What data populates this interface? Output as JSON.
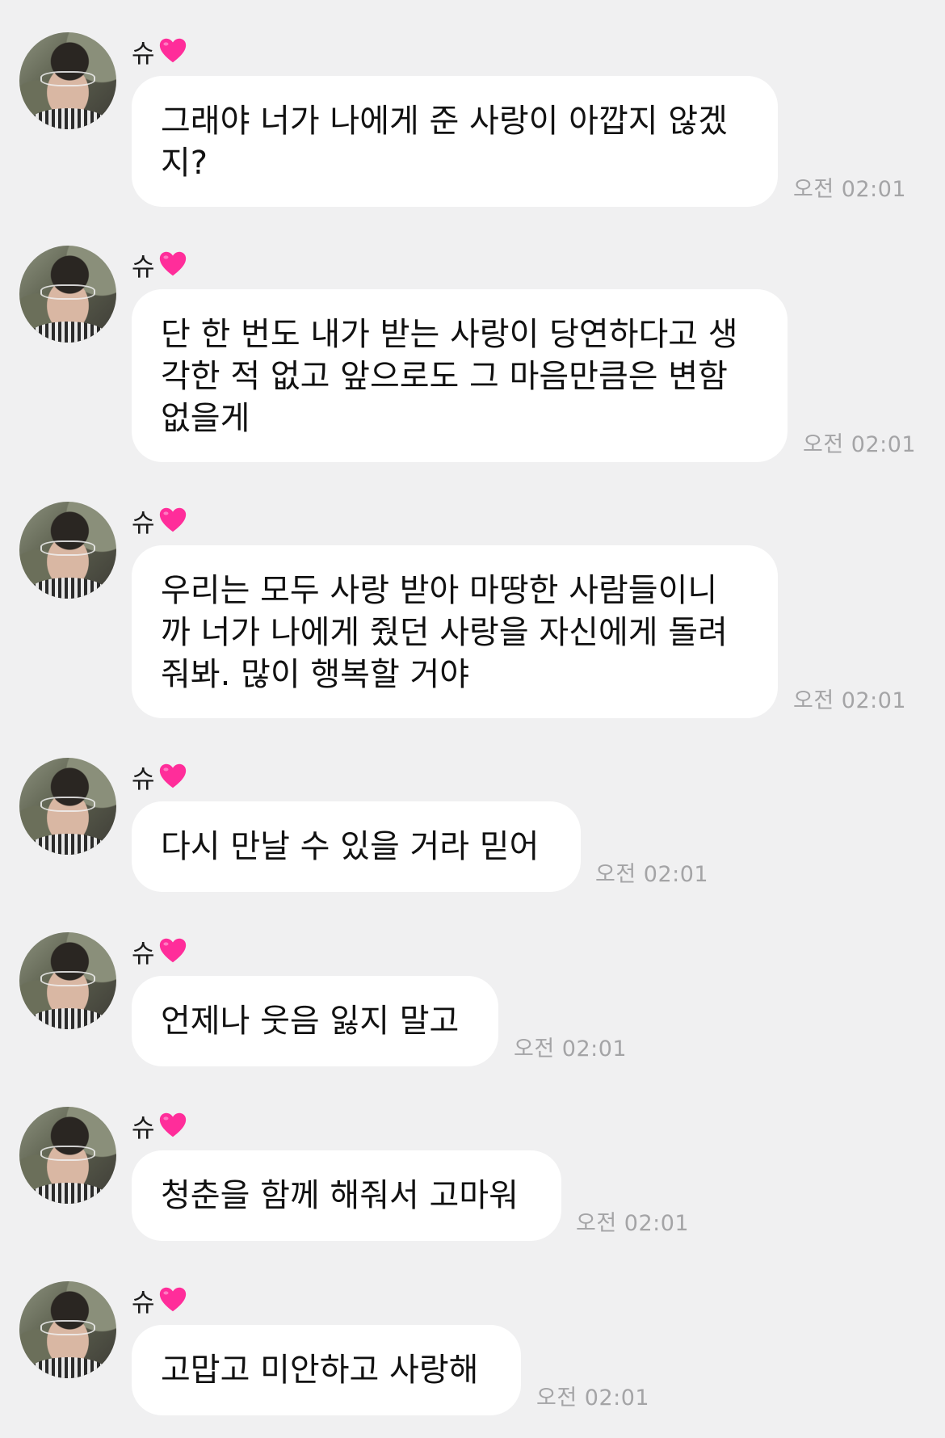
{
  "messages": [
    {
      "sender": "슈",
      "text": "그래야 너가 나에게 준 사랑이 아깝지 않겠\n지?",
      "time": "오전 02:01"
    },
    {
      "sender": "슈",
      "text": "단 한 번도 내가 받는 사랑이 당연하다고 생\n각한 적 없고 앞으로도 그 마음만큼은 변함\n없을게",
      "time": "오전 02:01"
    },
    {
      "sender": "슈",
      "text": "우리는 모두 사랑 받아 마땅한 사람들이니\n까 너가 나에게 줬던 사랑을 자신에게 돌려\n줘봐. 많이 행복할 거야",
      "time": "오전 02:01"
    },
    {
      "sender": "슈",
      "text": "다시 만날 수 있을 거라 믿어",
      "time": "오전 02:01"
    },
    {
      "sender": "슈",
      "text": "언제나 웃음 잃지 말고",
      "time": "오전 02:01"
    },
    {
      "sender": "슈",
      "text": "청춘을 함께 해줘서 고마워",
      "time": "오전 02:01"
    },
    {
      "sender": "슈",
      "text": "고맙고 미안하고 사랑해",
      "time": "오전 02:01"
    }
  ],
  "icons": {
    "heart": "heart-emoji",
    "avatar": "profile-photo"
  },
  "colors": {
    "background": "#f0f0f1",
    "bubble": "#ffffff",
    "heart": "#ff2d9a",
    "timestamp": "#a4a4a6"
  }
}
